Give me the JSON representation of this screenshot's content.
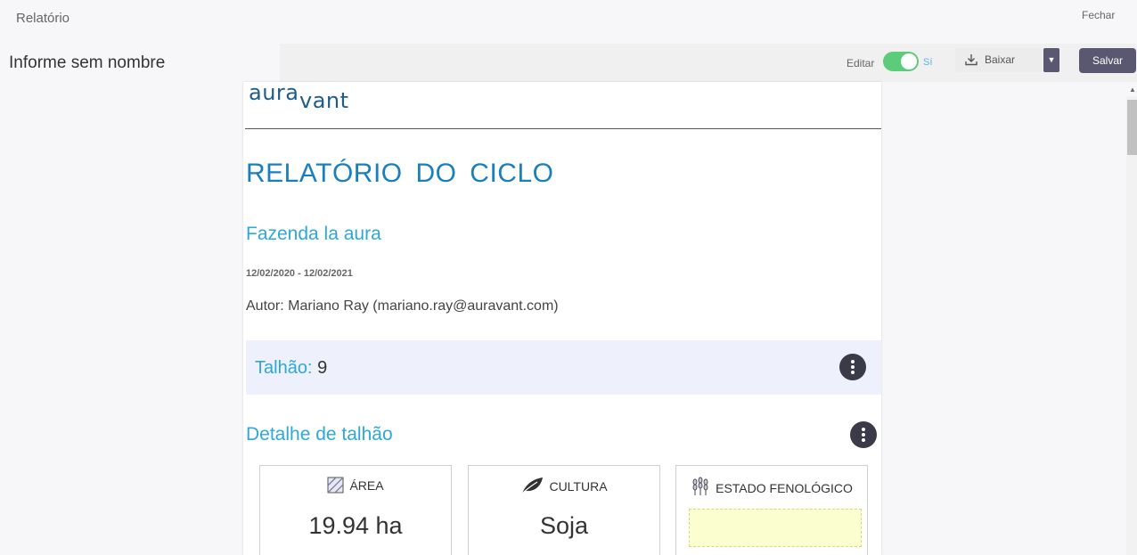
{
  "window": {
    "title": "Relatório",
    "close_label": "Fechar"
  },
  "report": {
    "name": "Informe sem nombre"
  },
  "toolbar": {
    "edit_label": "Editar",
    "edit_state": "Sí",
    "edit_enabled": true,
    "download_label": "Baixar",
    "save_label": "Salvar"
  },
  "document": {
    "logo_text": "auravant",
    "title": "RELATÓRIO DO CICLO",
    "farm": "Fazenda la aura",
    "date_range": "12/02/2020 - 12/02/2021",
    "author": "Autor: Mariano Ray (mariano.ray@auravant.com)",
    "plot": {
      "label": "Talhão:",
      "value": "9"
    },
    "detail_title": "Detalhe de talhão",
    "cards": [
      {
        "icon": "area-hatch-icon",
        "label": "ÁREA",
        "value": "19.94 ha"
      },
      {
        "icon": "leaf-icon",
        "label": "CULTURA",
        "value": "Soja"
      },
      {
        "icon": "wheat-icon",
        "label": "ESTADO FENOLÓGICO",
        "value": ""
      }
    ]
  },
  "colors": {
    "accent_blue": "#1a7fc0",
    "light_blue": "#2ea8d9",
    "toggle_on": "#5ccb7a",
    "button_dark": "#5a5870",
    "plot_band": "#eef0fc"
  }
}
